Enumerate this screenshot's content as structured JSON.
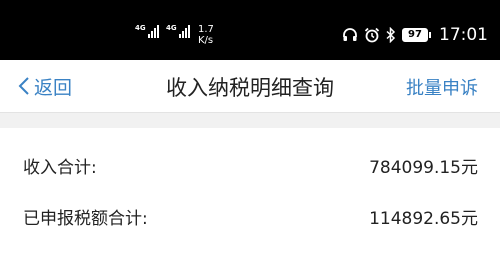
{
  "status_bar": {
    "signal_1": "4G",
    "signal_2": "4G",
    "net_speed_value": "1.7",
    "net_speed_unit": "K/s",
    "battery": "97",
    "time": "17:01",
    "icons": [
      "headphones-icon",
      "alarm-icon",
      "bluetooth-icon"
    ]
  },
  "nav": {
    "back_label": "返回",
    "title": "收入纳税明细查询",
    "action_label": "批量申诉"
  },
  "summary": {
    "income_label": "收入合计:",
    "income_value": "784099.15元",
    "tax_label": "已申报税额合计:",
    "tax_value": "114892.65元"
  }
}
